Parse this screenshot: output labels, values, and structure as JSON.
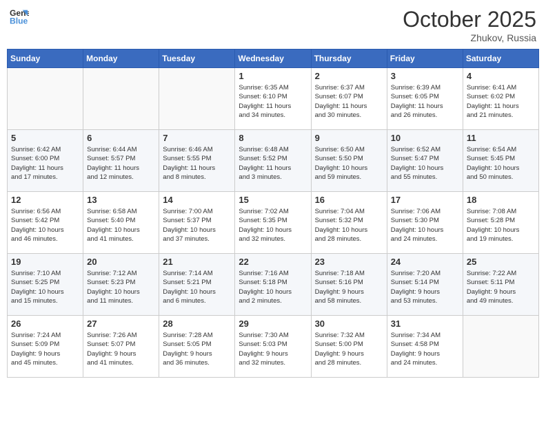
{
  "logo": {
    "line1": "General",
    "line2": "Blue"
  },
  "calendar": {
    "month": "October 2025",
    "location": "Zhukov, Russia",
    "days_of_week": [
      "Sunday",
      "Monday",
      "Tuesday",
      "Wednesday",
      "Thursday",
      "Friday",
      "Saturday"
    ],
    "weeks": [
      [
        {
          "day": "",
          "info": ""
        },
        {
          "day": "",
          "info": ""
        },
        {
          "day": "",
          "info": ""
        },
        {
          "day": "1",
          "info": "Sunrise: 6:35 AM\nSunset: 6:10 PM\nDaylight: 11 hours\nand 34 minutes."
        },
        {
          "day": "2",
          "info": "Sunrise: 6:37 AM\nSunset: 6:07 PM\nDaylight: 11 hours\nand 30 minutes."
        },
        {
          "day": "3",
          "info": "Sunrise: 6:39 AM\nSunset: 6:05 PM\nDaylight: 11 hours\nand 26 minutes."
        },
        {
          "day": "4",
          "info": "Sunrise: 6:41 AM\nSunset: 6:02 PM\nDaylight: 11 hours\nand 21 minutes."
        }
      ],
      [
        {
          "day": "5",
          "info": "Sunrise: 6:42 AM\nSunset: 6:00 PM\nDaylight: 11 hours\nand 17 minutes."
        },
        {
          "day": "6",
          "info": "Sunrise: 6:44 AM\nSunset: 5:57 PM\nDaylight: 11 hours\nand 12 minutes."
        },
        {
          "day": "7",
          "info": "Sunrise: 6:46 AM\nSunset: 5:55 PM\nDaylight: 11 hours\nand 8 minutes."
        },
        {
          "day": "8",
          "info": "Sunrise: 6:48 AM\nSunset: 5:52 PM\nDaylight: 11 hours\nand 3 minutes."
        },
        {
          "day": "9",
          "info": "Sunrise: 6:50 AM\nSunset: 5:50 PM\nDaylight: 10 hours\nand 59 minutes."
        },
        {
          "day": "10",
          "info": "Sunrise: 6:52 AM\nSunset: 5:47 PM\nDaylight: 10 hours\nand 55 minutes."
        },
        {
          "day": "11",
          "info": "Sunrise: 6:54 AM\nSunset: 5:45 PM\nDaylight: 10 hours\nand 50 minutes."
        }
      ],
      [
        {
          "day": "12",
          "info": "Sunrise: 6:56 AM\nSunset: 5:42 PM\nDaylight: 10 hours\nand 46 minutes."
        },
        {
          "day": "13",
          "info": "Sunrise: 6:58 AM\nSunset: 5:40 PM\nDaylight: 10 hours\nand 41 minutes."
        },
        {
          "day": "14",
          "info": "Sunrise: 7:00 AM\nSunset: 5:37 PM\nDaylight: 10 hours\nand 37 minutes."
        },
        {
          "day": "15",
          "info": "Sunrise: 7:02 AM\nSunset: 5:35 PM\nDaylight: 10 hours\nand 32 minutes."
        },
        {
          "day": "16",
          "info": "Sunrise: 7:04 AM\nSunset: 5:32 PM\nDaylight: 10 hours\nand 28 minutes."
        },
        {
          "day": "17",
          "info": "Sunrise: 7:06 AM\nSunset: 5:30 PM\nDaylight: 10 hours\nand 24 minutes."
        },
        {
          "day": "18",
          "info": "Sunrise: 7:08 AM\nSunset: 5:28 PM\nDaylight: 10 hours\nand 19 minutes."
        }
      ],
      [
        {
          "day": "19",
          "info": "Sunrise: 7:10 AM\nSunset: 5:25 PM\nDaylight: 10 hours\nand 15 minutes."
        },
        {
          "day": "20",
          "info": "Sunrise: 7:12 AM\nSunset: 5:23 PM\nDaylight: 10 hours\nand 11 minutes."
        },
        {
          "day": "21",
          "info": "Sunrise: 7:14 AM\nSunset: 5:21 PM\nDaylight: 10 hours\nand 6 minutes."
        },
        {
          "day": "22",
          "info": "Sunrise: 7:16 AM\nSunset: 5:18 PM\nDaylight: 10 hours\nand 2 minutes."
        },
        {
          "day": "23",
          "info": "Sunrise: 7:18 AM\nSunset: 5:16 PM\nDaylight: 9 hours\nand 58 minutes."
        },
        {
          "day": "24",
          "info": "Sunrise: 7:20 AM\nSunset: 5:14 PM\nDaylight: 9 hours\nand 53 minutes."
        },
        {
          "day": "25",
          "info": "Sunrise: 7:22 AM\nSunset: 5:11 PM\nDaylight: 9 hours\nand 49 minutes."
        }
      ],
      [
        {
          "day": "26",
          "info": "Sunrise: 7:24 AM\nSunset: 5:09 PM\nDaylight: 9 hours\nand 45 minutes."
        },
        {
          "day": "27",
          "info": "Sunrise: 7:26 AM\nSunset: 5:07 PM\nDaylight: 9 hours\nand 41 minutes."
        },
        {
          "day": "28",
          "info": "Sunrise: 7:28 AM\nSunset: 5:05 PM\nDaylight: 9 hours\nand 36 minutes."
        },
        {
          "day": "29",
          "info": "Sunrise: 7:30 AM\nSunset: 5:03 PM\nDaylight: 9 hours\nand 32 minutes."
        },
        {
          "day": "30",
          "info": "Sunrise: 7:32 AM\nSunset: 5:00 PM\nDaylight: 9 hours\nand 28 minutes."
        },
        {
          "day": "31",
          "info": "Sunrise: 7:34 AM\nSunset: 4:58 PM\nDaylight: 9 hours\nand 24 minutes."
        },
        {
          "day": "",
          "info": ""
        }
      ]
    ]
  }
}
